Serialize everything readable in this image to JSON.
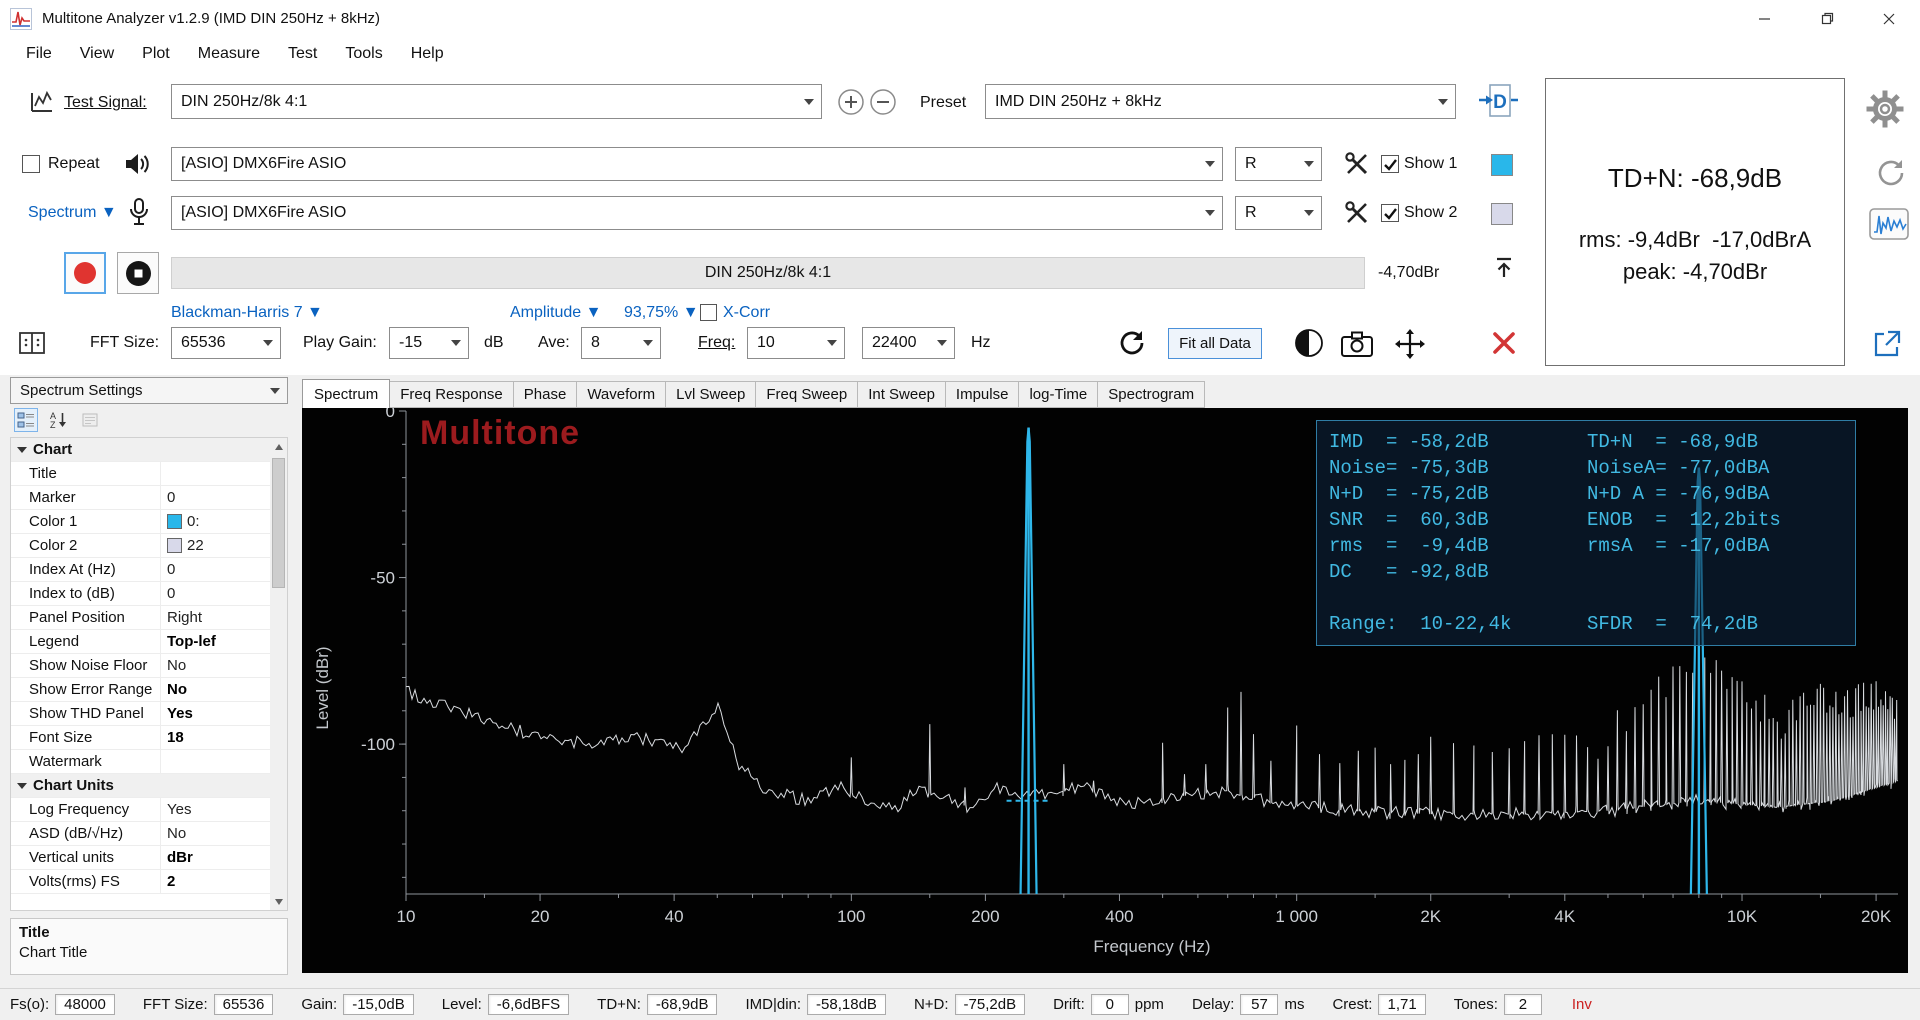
{
  "window": {
    "title": "Multitone Analyzer v1.2.9 (IMD DIN 250Hz + 8kHz)"
  },
  "menu": {
    "items": [
      "File",
      "View",
      "Plot",
      "Measure",
      "Test",
      "Tools",
      "Help"
    ]
  },
  "toolbar": {
    "test_signal_label": "Test Signal:",
    "test_signal_value": "DIN 250Hz/8k 4:1",
    "preset_label": "Preset",
    "preset_value": "IMD DIN 250Hz + 8kHz",
    "repeat_label": "Repeat",
    "repeat_checked": false,
    "output_device": "[ASIO] DMX6Fire ASIO",
    "output_channel": "R",
    "show1_label": "Show 1",
    "show1_checked": true,
    "show1_color": "#29b7ea",
    "input_mode": "Spectrum ▼",
    "input_device": "[ASIO] DMX6Fire ASIO",
    "input_channel": "R",
    "show2_label": "Show 2",
    "show2_checked": true,
    "show2_color": "#d8d9ea",
    "progress_text": "DIN 250Hz/8k 4:1",
    "progress_level": "-4,70dBr",
    "window_fn": "Blackman-Harris 7 ▼",
    "amplitude_label": "Amplitude ▼",
    "amplitude_value": "93,75% ▼",
    "xcorr_label": "X-Corr",
    "xcorr_checked": false,
    "fft_label": "FFT Size:",
    "fft_value": "65536",
    "gain_label": "Play Gain:",
    "gain_value": "-15",
    "gain_unit": "dB",
    "ave_label": "Ave:",
    "ave_value": "8",
    "freq_label": "Freq:",
    "freq_lo": "10",
    "freq_hi": "22400",
    "freq_unit": "Hz",
    "fit_button": "Fit all Data"
  },
  "readings": {
    "tdn": "TD+N: -68,9dB",
    "rms": "rms: -9,4dBr  -17,0dBrA",
    "peak": "peak: -4,70dBr"
  },
  "settings_panel": {
    "selector": "Spectrum Settings",
    "groups": [
      {
        "name": "Chart",
        "rows": [
          {
            "label": "Title",
            "value": ""
          },
          {
            "label": "Marker",
            "value": "0"
          },
          {
            "label": "Color 1",
            "value": "0:",
            "swatch": "#29b7ea"
          },
          {
            "label": "Color 2",
            "value": "22",
            "swatch": "#d8d9ea"
          },
          {
            "label": "Index At (Hz)",
            "value": "0"
          },
          {
            "label": "Index to (dB)",
            "value": "0"
          },
          {
            "label": "Panel Position",
            "value": "Right"
          },
          {
            "label": "Legend",
            "value": "Top-lef",
            "bold": true
          },
          {
            "label": "Show Noise Floor",
            "value": "No"
          },
          {
            "label": "Show Error Range",
            "value": "No",
            "bold": true
          },
          {
            "label": "Show THD Panel",
            "value": "Yes",
            "bold": true
          },
          {
            "label": "Font Size",
            "value": "18",
            "bold": true
          },
          {
            "label": "Watermark",
            "value": ""
          }
        ]
      },
      {
        "name": "Chart Units",
        "rows": [
          {
            "label": "Log Frequency",
            "value": "Yes"
          },
          {
            "label": "ASD (dB/√Hz)",
            "value": "No"
          },
          {
            "label": "Vertical units",
            "value": "dBr",
            "bold": true
          },
          {
            "label": "Volts(rms) FS",
            "value": "2",
            "bold": true
          }
        ]
      }
    ],
    "help_title": "Title",
    "help_text": "Chart Title"
  },
  "tabs": {
    "items": [
      "Spectrum",
      "Freq Response",
      "Phase",
      "Waveform",
      "Lvl Sweep",
      "Freq Sweep",
      "Int Sweep",
      "Impulse",
      "log-Time",
      "Spectrogram"
    ],
    "selected": 0
  },
  "chart": {
    "type": "line",
    "watermark": "Multitone",
    "ylabel": "Level (dBr)",
    "xlabel": "Frequency (Hz)",
    "accent": "#2fb7ea",
    "x_range_hz": [
      10,
      22400
    ],
    "y_range_db": [
      -145,
      0
    ],
    "x_ticks": [
      {
        "f": 10,
        "label": "10"
      },
      {
        "f": 20,
        "label": "20"
      },
      {
        "f": 40,
        "label": "40"
      },
      {
        "f": 100,
        "label": "100"
      },
      {
        "f": 200,
        "label": "200"
      },
      {
        "f": 400,
        "label": "400"
      },
      {
        "f": 1000,
        "label": "1 000"
      },
      {
        "f": 2000,
        "label": "2K"
      },
      {
        "f": 4000,
        "label": "4K"
      },
      {
        "f": 10000,
        "label": "10K"
      },
      {
        "f": 20000,
        "label": "20K"
      }
    ],
    "y_ticks": [
      {
        "db": 0,
        "label": "0"
      },
      {
        "db": -50,
        "label": "-50"
      },
      {
        "db": -100,
        "label": "-100"
      }
    ],
    "tones": [
      {
        "freq": 250,
        "db": -5
      },
      {
        "freq": 8000,
        "db": -17
      }
    ],
    "noise_floor": [
      [
        10,
        -84
      ],
      [
        13,
        -90
      ],
      [
        18,
        -96
      ],
      [
        25,
        -100
      ],
      [
        33,
        -98
      ],
      [
        42,
        -102
      ],
      [
        50,
        -88
      ],
      [
        56,
        -107
      ],
      [
        65,
        -114
      ],
      [
        80,
        -117
      ],
      [
        95,
        -113
      ],
      [
        108,
        -117
      ],
      [
        125,
        -120
      ],
      [
        140,
        -113
      ],
      [
        160,
        -116
      ],
      [
        185,
        -119
      ],
      [
        215,
        -113
      ],
      [
        240,
        -116
      ],
      [
        280,
        -115
      ],
      [
        330,
        -113
      ],
      [
        420,
        -118
      ],
      [
        520,
        -116
      ],
      [
        700,
        -114
      ],
      [
        900,
        -118
      ],
      [
        1300,
        -120
      ],
      [
        2000,
        -121
      ],
      [
        3200,
        -121
      ],
      [
        5000,
        -120
      ],
      [
        8000,
        -117
      ],
      [
        12000,
        -119
      ],
      [
        16000,
        -117
      ],
      [
        22400,
        -111
      ]
    ],
    "clusters": [
      {
        "c": 3.9031,
        "p": -76,
        "k": 200,
        "e": 1.4
      },
      {
        "c": 4.2041,
        "p": -86,
        "k": 400,
        "e": 1.8
      },
      {
        "c": 2.8751,
        "p": -87,
        "k": 350,
        "e": 1.8
      },
      {
        "c": 4.297,
        "p": -86,
        "k": 500,
        "e": 1.9
      },
      {
        "c": 3.45,
        "p": -98,
        "k": 40,
        "e": 1.3
      }
    ],
    "extra_spikes": [
      [
        100,
        -104
      ],
      [
        150,
        -94
      ],
      [
        180,
        -113
      ],
      [
        300,
        -106
      ],
      [
        350,
        -111
      ],
      [
        560,
        -109
      ],
      [
        625,
        -106
      ],
      [
        700,
        -89
      ],
      [
        800,
        -97
      ],
      [
        875,
        -105
      ],
      [
        1125,
        -103
      ],
      [
        1375,
        -102
      ],
      [
        1625,
        -106
      ],
      [
        1875,
        -103
      ]
    ],
    "panel": {
      "rows": [
        {
          "l": "IMD  = -58,2dB",
          "r": "TD+N  = -68,9dB"
        },
        {
          "l": "Noise= -75,3dB",
          "r": "NoiseA= -77,0dBA"
        },
        {
          "l": "N+D  = -75,2dB",
          "r": "N+D A = -76,9dBA"
        },
        {
          "l": "SNR  =  60,3dB",
          "r": "ENOB  =  12,2bits"
        },
        {
          "l": "rms  =  -9,4dB",
          "r": "rmsA  = -17,0dBA"
        },
        {
          "l": "DC   = -92,8dB",
          "r": ""
        },
        {
          "l": "",
          "r": ""
        },
        {
          "l": "Range:  10-22,4k",
          "r": "SFDR  =  74,2dB"
        }
      ]
    }
  },
  "status": {
    "items": [
      {
        "label": "Fs(o):",
        "value": "48000"
      },
      {
        "label": "FFT Size:",
        "value": "65536"
      },
      {
        "label": "Gain:",
        "value": "-15,0dB"
      },
      {
        "label": "Level:",
        "value": "-6,6dBFS"
      },
      {
        "label": "TD+N:",
        "value": "-68,9dB"
      },
      {
        "label": "IMD|din:",
        "value": "-58,18dB"
      },
      {
        "label": "N+D:",
        "value": "-75,2dB"
      },
      {
        "label": "Drift:",
        "value": "0",
        "unit": "ppm"
      },
      {
        "label": "Delay:",
        "value": "57",
        "unit": "ms"
      },
      {
        "label": "Crest:",
        "value": "1,71"
      },
      {
        "label": "Tones:",
        "value": "2"
      }
    ],
    "inv": "Inv"
  }
}
